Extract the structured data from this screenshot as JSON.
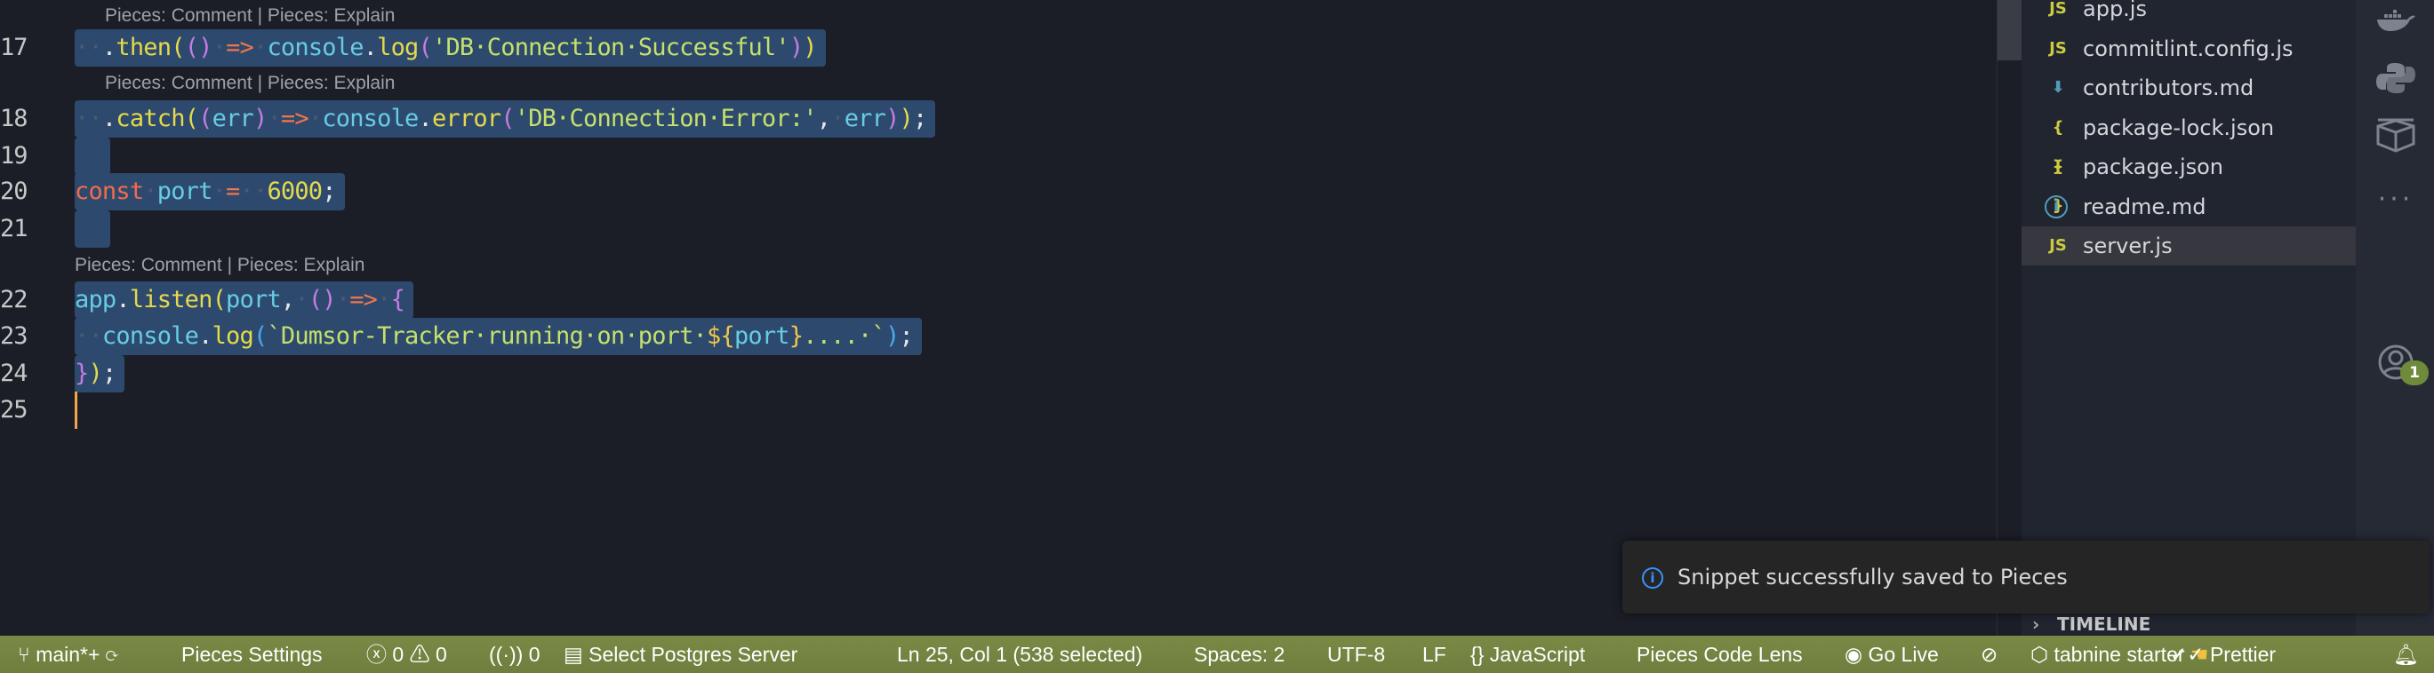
{
  "editor": {
    "codelens": {
      "comment": "Pieces: Comment",
      "sep": " | ",
      "explain": "Pieces: Explain"
    },
    "lines": [
      {
        "num": "17",
        "tokens": [
          [
            "ws",
            "··"
          ],
          [
            "pl",
            "."
          ],
          [
            "fn",
            "then"
          ],
          [
            "fn",
            "("
          ],
          [
            "p",
            "()"
          ],
          [
            "ws",
            "·"
          ],
          [
            "op",
            "=>"
          ],
          [
            "ws",
            "·"
          ],
          [
            "var",
            "console"
          ],
          [
            "pl",
            "."
          ],
          [
            "fn",
            "log"
          ],
          [
            "p",
            "("
          ],
          [
            "str",
            "'DB·Connection·Successful'"
          ],
          [
            "p",
            ")"
          ],
          [
            "fn",
            ")"
          ]
        ]
      },
      {
        "num": "18",
        "tokens": [
          [
            "ws",
            "··"
          ],
          [
            "pl",
            "."
          ],
          [
            "fn",
            "catch"
          ],
          [
            "fn",
            "("
          ],
          [
            "p",
            "("
          ],
          [
            "var",
            "err"
          ],
          [
            "p",
            ")"
          ],
          [
            "ws",
            "·"
          ],
          [
            "op",
            "=>"
          ],
          [
            "ws",
            "·"
          ],
          [
            "var",
            "console"
          ],
          [
            "pl",
            "."
          ],
          [
            "fn",
            "error"
          ],
          [
            "p",
            "("
          ],
          [
            "str",
            "'DB·Connection·Error:'"
          ],
          [
            "pl",
            ","
          ],
          [
            "ws",
            "·"
          ],
          [
            "var",
            "err"
          ],
          [
            "p",
            ")"
          ],
          [
            "fn",
            ")"
          ],
          [
            "pl",
            ";"
          ]
        ]
      },
      {
        "num": "19",
        "tokens": []
      },
      {
        "num": "20",
        "tokens": [
          [
            "kw",
            "const"
          ],
          [
            "ws",
            "·"
          ],
          [
            "var",
            "port"
          ],
          [
            "ws",
            "·"
          ],
          [
            "op",
            "="
          ],
          [
            "ws",
            "··"
          ],
          [
            "num",
            "6000"
          ],
          [
            "pl",
            ";"
          ]
        ]
      },
      {
        "num": "21",
        "tokens": []
      },
      {
        "num": "22",
        "tokens": [
          [
            "var",
            "app"
          ],
          [
            "pl",
            "."
          ],
          [
            "fn",
            "listen"
          ],
          [
            "fn",
            "("
          ],
          [
            "var",
            "port"
          ],
          [
            "pl",
            ","
          ],
          [
            "ws",
            "·"
          ],
          [
            "p",
            "()"
          ],
          [
            "ws",
            "·"
          ],
          [
            "op",
            "=>"
          ],
          [
            "ws",
            "·"
          ],
          [
            "p",
            "{"
          ]
        ]
      },
      {
        "num": "23",
        "tokens": [
          [
            "ws",
            "··"
          ],
          [
            "var",
            "console"
          ],
          [
            "pl",
            "."
          ],
          [
            "fn",
            "log"
          ],
          [
            "bq",
            "("
          ],
          [
            "str",
            "`Dumsor-Tracker·running·on·port·"
          ],
          [
            "tpl",
            "${"
          ],
          [
            "var",
            "port"
          ],
          [
            "tpl",
            "}"
          ],
          [
            "str",
            "....·`"
          ],
          [
            "bq",
            ")"
          ],
          [
            "pl",
            ";"
          ]
        ]
      },
      {
        "num": "24",
        "tokens": [
          [
            "p",
            "}"
          ],
          [
            "fn",
            ")"
          ],
          [
            "pl",
            ";"
          ]
        ]
      },
      {
        "num": "25",
        "tokens": []
      }
    ]
  },
  "explorer": {
    "files": [
      {
        "icon": "JS",
        "name": "app.js",
        "type": "js"
      },
      {
        "icon": "JS",
        "name": "commitlint.config.js",
        "type": "js"
      },
      {
        "icon": "⬇",
        "name": "contributors.md",
        "type": "md"
      },
      {
        "icon": "{ }",
        "name": "package-lock.json",
        "type": "json"
      },
      {
        "icon": "{ }",
        "name": "package.json",
        "type": "json"
      },
      {
        "icon": "i",
        "name": "readme.md",
        "type": "info"
      },
      {
        "icon": "JS",
        "name": "server.js",
        "type": "js"
      }
    ],
    "timeline": "TIMELINE"
  },
  "activity": {
    "badge": "1"
  },
  "toast": {
    "message": "Snippet successfully saved to Pieces"
  },
  "status": {
    "branch": "main*+",
    "pieces_settings": "Pieces Settings",
    "errors": "0",
    "warnings": "0",
    "ports": "0",
    "postgres": "Select Postgres Server",
    "position": "Ln 25, Col 1 (538 selected)",
    "spaces": "Spaces: 2",
    "encoding": "UTF-8",
    "eol": "LF",
    "language": "JavaScript",
    "code_lens": "Pieces Code Lens",
    "go_live": "Go Live",
    "tabnine": "tabnine starter",
    "prettier": "Prettier"
  },
  "colors": {
    "statusbar": "#7a8a45",
    "selection": "#2d4a6e",
    "editor_bg": "#1b1e27"
  }
}
